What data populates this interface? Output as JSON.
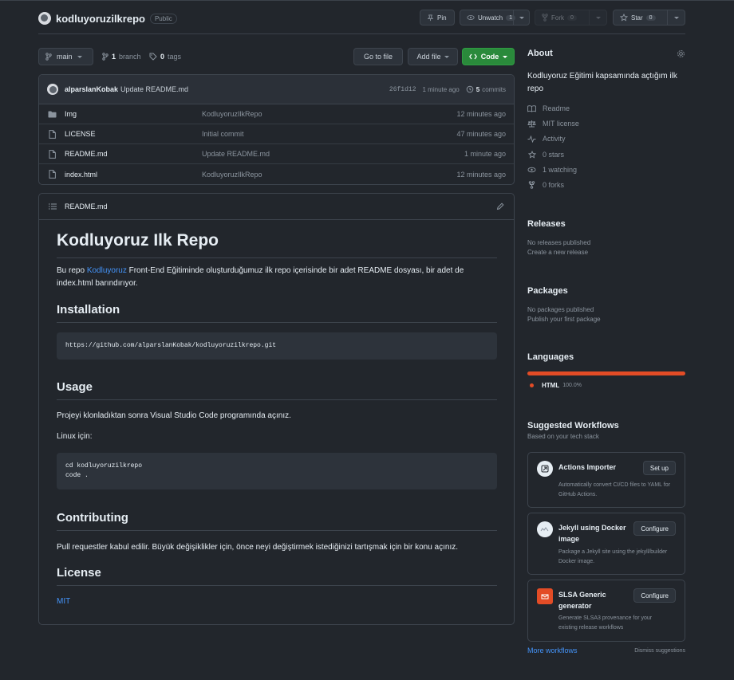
{
  "repo": {
    "name": "kodluyoruzilkrepo",
    "visibility": "Public",
    "pin_label": "Pin",
    "watch_label": "Unwatch",
    "watch_count": "1",
    "fork_label": "Fork",
    "fork_count": "0",
    "star_label": "Star",
    "star_count": "0"
  },
  "toolbar": {
    "branch": "main",
    "branches_count": "1",
    "branches_label": "branch",
    "tags_count": "0",
    "tags_label": "tags",
    "go_to_file": "Go to file",
    "add_file": "Add file",
    "code": "Code"
  },
  "commit": {
    "author": "alparslanKobak",
    "message": "Update README.md",
    "hash": "26f1d12",
    "time": "1 minute ago",
    "commits_count": "5",
    "commits_label": "commits"
  },
  "files": [
    {
      "name": "Img",
      "type": "folder",
      "message": "KodluyoruzIlkRepo",
      "age": "12 minutes ago"
    },
    {
      "name": "LICENSE",
      "type": "file",
      "message": "Initial commit",
      "age": "47 minutes ago"
    },
    {
      "name": "README.md",
      "type": "file",
      "message": "Update README.md",
      "age": "1 minute ago"
    },
    {
      "name": "index.html",
      "type": "file",
      "message": "KodluyoruzIlkRepo",
      "age": "12 minutes ago"
    }
  ],
  "readme": {
    "filename": "README.md",
    "title": "Kodluyoruz Ilk Repo",
    "intro_before": "Bu repo ",
    "intro_link": "Kodluyoruz",
    "intro_after": " Front-End Eğitiminde oluşturduğumuz ilk repo içerisinde bir adet README dosyası, bir adet de index.html barındırıyor.",
    "installation_heading": "Installation",
    "install_code": "https://github.com/alparslanKobak/kodluyoruzilkrepo.git",
    "usage_heading": "Usage",
    "usage_text": "Projeyi klonladıktan sonra Visual Studio Code programında açınız.",
    "linux_text": "Linux için:",
    "usage_code_line1": "cd kodluyoruzilkrepo",
    "usage_code_line2": "code .",
    "contributing_heading": "Contributing",
    "contributing_text": "Pull requestler kabul edilir. Büyük değişiklikler için, önce neyi değiştirmek istediğinizi tartışmak için bir konu açınız.",
    "license_heading": "License",
    "license_link": "MIT"
  },
  "about": {
    "heading": "About",
    "description": "Kodluyoruz Eğitimi kapsamında açtığım ilk repo",
    "items": [
      {
        "icon": "book-icon",
        "label": "Readme"
      },
      {
        "icon": "scale-icon",
        "label": "MIT license"
      },
      {
        "icon": "pulse-icon",
        "label": "Activity"
      },
      {
        "icon": "star-icon",
        "label": "0 stars"
      },
      {
        "icon": "eye-icon",
        "label": "1 watching"
      },
      {
        "icon": "fork-icon",
        "label": "0 forks"
      }
    ]
  },
  "releases": {
    "heading": "Releases",
    "empty": "No releases published",
    "create_link": "Create a new release"
  },
  "packages": {
    "heading": "Packages",
    "empty": "No packages published",
    "publish_link": "Publish your first package"
  },
  "languages": {
    "heading": "Languages",
    "items": [
      {
        "name": "HTML",
        "percent": "100.0%",
        "fraction": 1.0,
        "color": "#e34c26"
      }
    ]
  },
  "workflows": {
    "heading": "Suggested Workflows",
    "subheading": "Based on your tech stack",
    "items": [
      {
        "title": "Actions Importer",
        "description": "Automatically convert CI/CD files to YAML for GitHub Actions.",
        "button": "Set up"
      },
      {
        "title": "Jekyll using Docker image",
        "description": "Package a Jekyll site using the jekyll/builder Docker image.",
        "button": "Configure"
      },
      {
        "title": "SLSA Generic generator",
        "description": "Generate SLSA3 provenance for your existing release workflows",
        "button": "Configure"
      }
    ],
    "more": "More workflows",
    "dismiss": "Dismiss suggestions"
  },
  "colors": {
    "accent_green": "#2a8a3b",
    "link_blue": "#4493f8",
    "html_lang": "#e34c26",
    "background": "#22262c"
  }
}
